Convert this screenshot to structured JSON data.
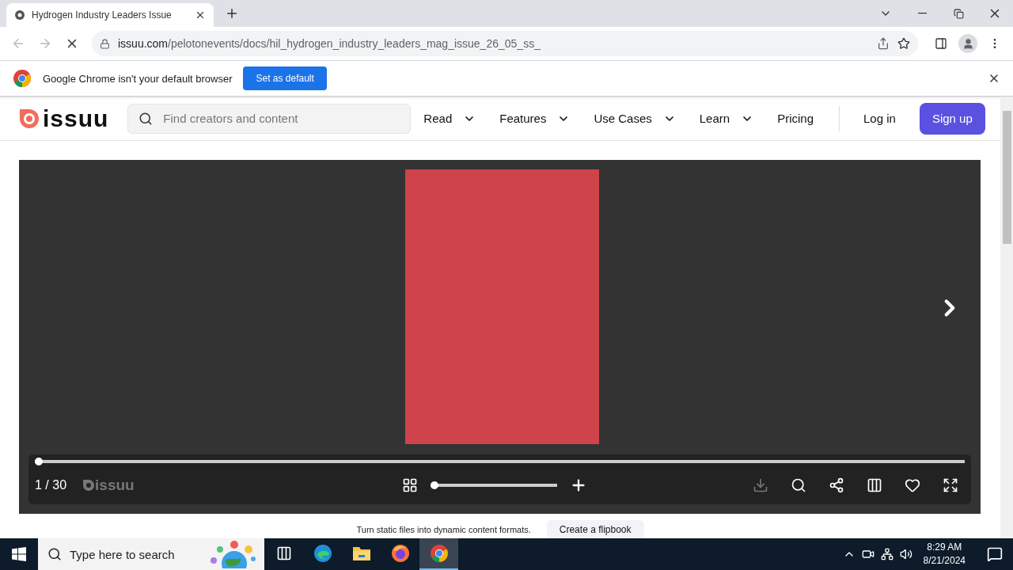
{
  "browser": {
    "tab": {
      "title": "Hydrogen Industry Leaders Issue"
    },
    "loading": true,
    "url": {
      "domain": "issuu.com",
      "path": "/pelotonevents/docs/hil_hydrogen_industry_leaders_mag_issue_26_05_ss_"
    }
  },
  "infobar": {
    "message": "Google Chrome isn't your default browser",
    "button": "Set as default"
  },
  "site": {
    "logo_text": "issuu",
    "search": {
      "placeholder": "Find creators and content"
    },
    "nav": [
      {
        "label": "Read",
        "dropdown": true
      },
      {
        "label": "Features",
        "dropdown": true
      },
      {
        "label": "Use Cases",
        "dropdown": true
      },
      {
        "label": "Learn",
        "dropdown": true
      },
      {
        "label": "Pricing",
        "dropdown": false
      }
    ],
    "login": "Log in",
    "signup": "Sign up"
  },
  "viewer": {
    "page_counter": "1 / 30",
    "brand": "issuu",
    "progress": {
      "level": 0
    },
    "zoom": {
      "level": 0
    }
  },
  "promo": {
    "text": "Turn static files into dynamic content formats.",
    "button": "Create a flipbook"
  },
  "taskbar": {
    "search": {
      "placeholder": "Type here to search"
    },
    "apps": [
      {
        "kind": "taskview",
        "selected": false
      },
      {
        "kind": "edge",
        "selected": false
      },
      {
        "kind": "explorer",
        "selected": false
      },
      {
        "kind": "firefox",
        "selected": false
      },
      {
        "kind": "chrome",
        "selected": true
      }
    ],
    "time": "8:29 AM",
    "date": "8/21/2024"
  }
}
